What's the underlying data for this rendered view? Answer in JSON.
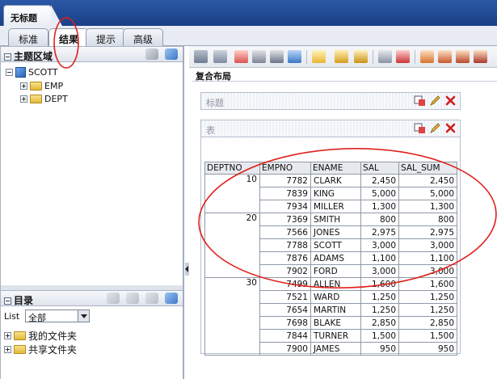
{
  "window": {
    "doc_tab": "无标题"
  },
  "mode_tabs": [
    {
      "label": "标准",
      "active": false
    },
    {
      "label": "结果",
      "active": true
    },
    {
      "label": "提示",
      "active": false
    },
    {
      "label": "高级",
      "active": false
    }
  ],
  "subject_panel": {
    "title": "主题区域",
    "root": "SCOTT",
    "children": [
      "EMP",
      "DEPT"
    ]
  },
  "catalog_panel": {
    "title": "目录",
    "list_label": "List",
    "select_value": "全部",
    "folders": [
      "我的文件夹",
      "共享文件夹"
    ]
  },
  "canvas": {
    "title": "复合布局",
    "title_section": "标题",
    "table_section": "表"
  },
  "table": {
    "columns": [
      "DEPTNO",
      "EMPNO",
      "ENAME",
      "SAL",
      "SAL_SUM"
    ],
    "groups": [
      {
        "deptno": "10",
        "rows": [
          [
            "7782",
            "CLARK",
            "2,450",
            "2,450"
          ],
          [
            "7839",
            "KING",
            "5,000",
            "5,000"
          ],
          [
            "7934",
            "MILLER",
            "1,300",
            "1,300"
          ]
        ]
      },
      {
        "deptno": "20",
        "rows": [
          [
            "7369",
            "SMITH",
            "800",
            "800"
          ],
          [
            "7566",
            "JONES",
            "2,975",
            "2,975"
          ],
          [
            "7788",
            "SCOTT",
            "3,000",
            "3,000"
          ],
          [
            "7876",
            "ADAMS",
            "1,100",
            "1,100"
          ],
          [
            "7902",
            "FORD",
            "3,000",
            "3,000"
          ]
        ]
      },
      {
        "deptno": "30",
        "rows": [
          [
            "7499",
            "ALLEN",
            "1,600",
            "1,600"
          ],
          [
            "7521",
            "WARD",
            "1,250",
            "1,250"
          ],
          [
            "7654",
            "MARTIN",
            "1,250",
            "1,250"
          ],
          [
            "7698",
            "BLAKE",
            "2,850",
            "2,850"
          ],
          [
            "7844",
            "TURNER",
            "1,500",
            "1,500"
          ],
          [
            "7900",
            "JAMES",
            "950",
            "950"
          ]
        ]
      }
    ]
  },
  "colors": {
    "annotation": "#e0201c",
    "accent": "#1a3f86"
  }
}
